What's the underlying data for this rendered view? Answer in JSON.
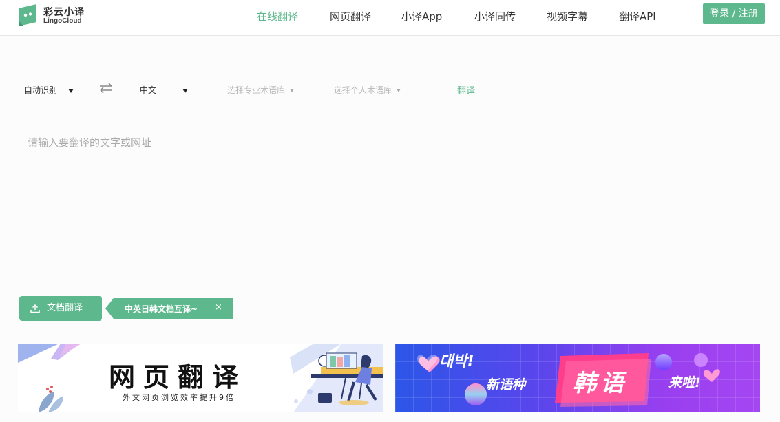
{
  "brand": {
    "name_cn": "彩云小译",
    "name_en": "LingoCloud",
    "accent": "#5db88d"
  },
  "nav": {
    "items": [
      {
        "label": "在线翻译",
        "active": true
      },
      {
        "label": "网页翻译",
        "active": false
      },
      {
        "label": "小译App",
        "active": false
      },
      {
        "label": "小译同传",
        "active": false
      },
      {
        "label": "视频字幕",
        "active": false
      },
      {
        "label": "翻译API",
        "active": false
      }
    ],
    "login_label": "登录 / 注册"
  },
  "toolbar": {
    "source_lang": "自动识别",
    "target_lang": "中文",
    "glossary_pro": "选择专业术语库",
    "glossary_personal": "选择个人术语库",
    "translate_label": "翻译",
    "swap_icon": "swap-arrows-icon"
  },
  "input": {
    "placeholder": "请输入要翻译的文字或网址",
    "value": ""
  },
  "doc": {
    "button_label": "文档翻译",
    "tip_label": "中英日韩文档互译~",
    "close_glyph": "×",
    "upload_icon": "upload-icon"
  },
  "banners": {
    "web": {
      "title": "网页翻译",
      "subtitle": "外文网页浏览效率提升9倍"
    },
    "korean": {
      "korean_text": "대박!",
      "new_language": "新语种",
      "language": "韩语",
      "arrived": "来啦!"
    }
  }
}
